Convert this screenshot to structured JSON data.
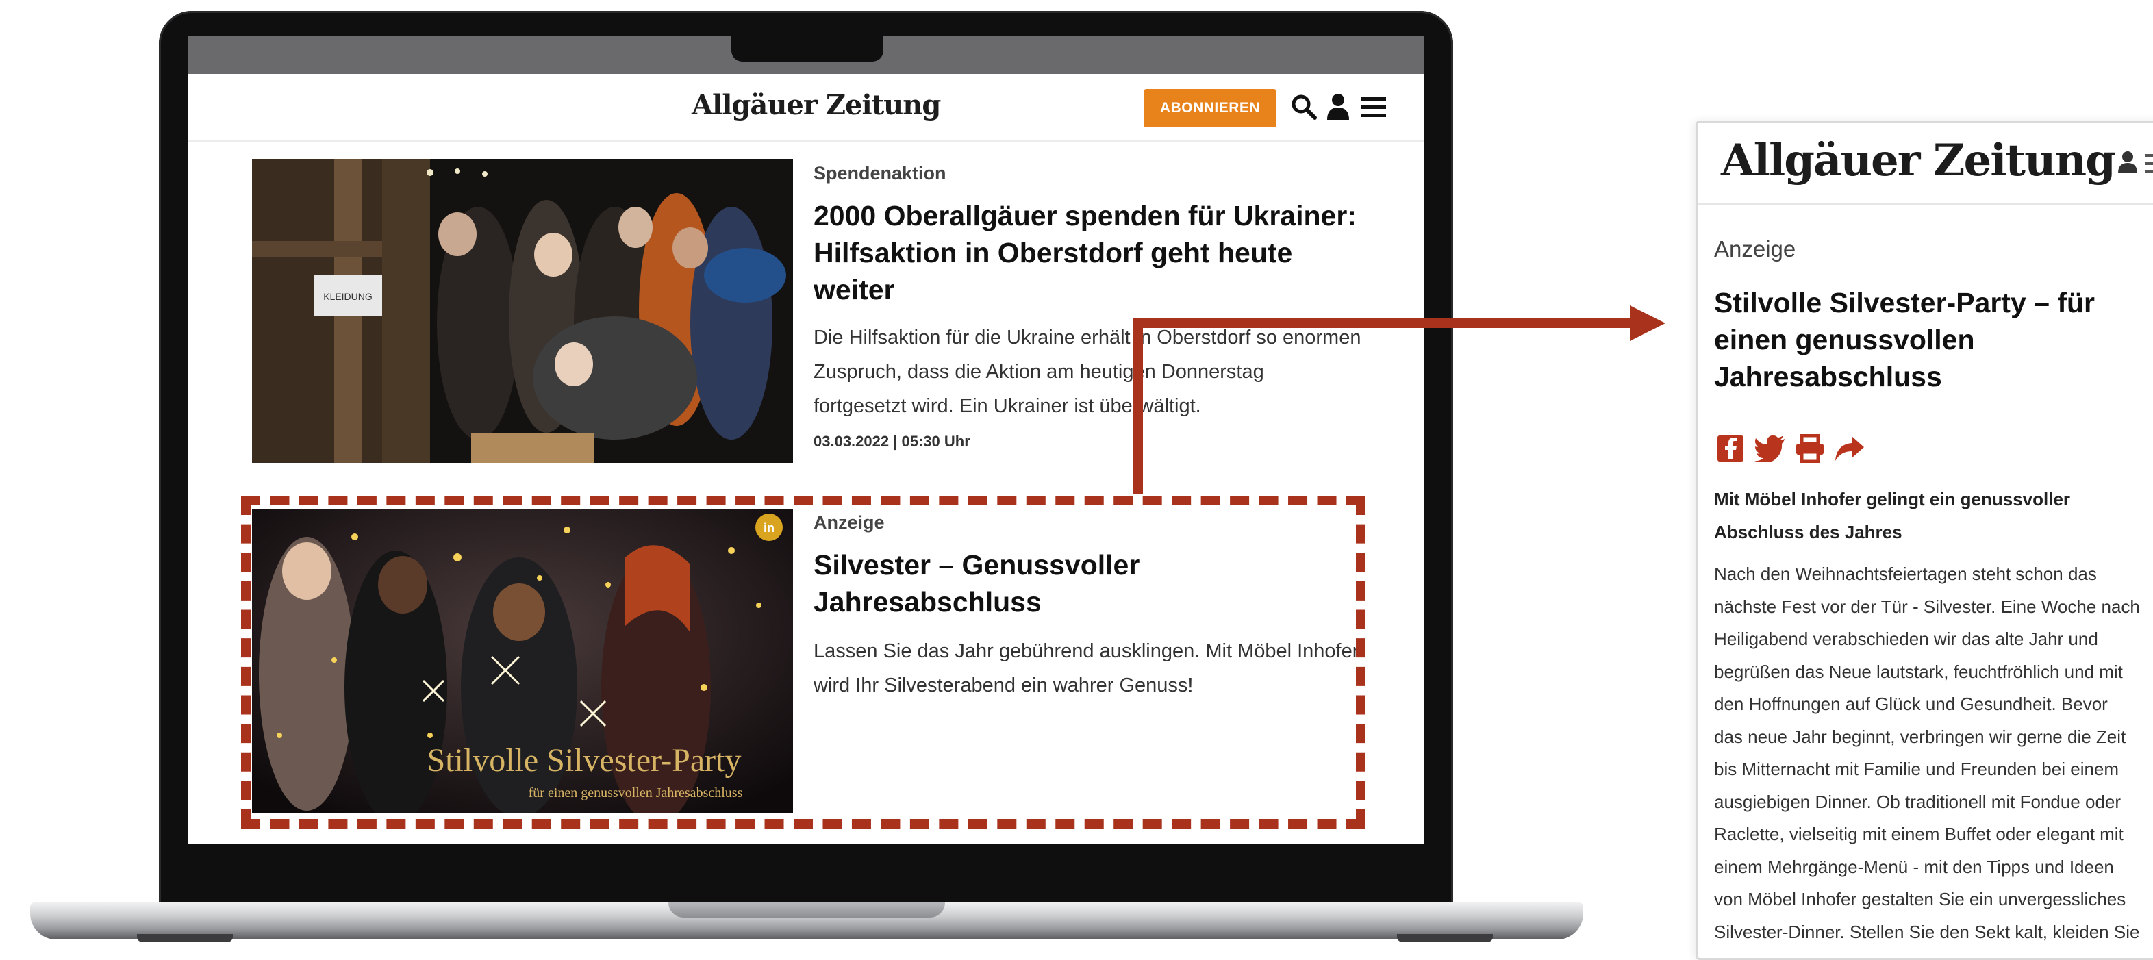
{
  "laptop": {
    "site": {
      "logo": "Allgäuer Zeitung",
      "subscribe_label": "ABONNIEREN",
      "header_icons": [
        "search-icon",
        "user-icon",
        "menu-icon"
      ]
    },
    "articles": [
      {
        "kicker": "Spendenaktion",
        "title": "2000 Oberallgäuer spenden für Ukrainer: Hilfsaktion in Oberstdorf geht heute weiter",
        "teaser": "Die Hilfsaktion für die Ukraine erhält in Oberstdorf so enormen Zuspruch, dass die Aktion am heutigen Donnerstag fortgesetzt wird. Ein Ukrainer ist überwältigt.",
        "date": "03.03.2022 | 05:30 Uhr",
        "image_sign": "KLEIDUNG"
      },
      {
        "kicker": "Anzeige",
        "title": "Silvester – Genussvoller Jahresabschluss",
        "teaser": "Lassen Sie das Jahr gebührend ausklingen. Mit Möbel Inhofer wird Ihr Silvesterabend ein wahrer Genuss!",
        "image_caption": "Stilvolle Silvester-Party",
        "image_subcaption": "für einen genussvollen Jahresabschluss"
      }
    ]
  },
  "phone": {
    "logo": "Allgäuer Zeitung",
    "kicker": "Anzeige",
    "title": "Stilvolle Silvester-Party – für einen genussvollen Jahresabschluss",
    "share_icons": [
      "facebook-icon",
      "twitter-icon",
      "print-icon",
      "share-icon"
    ],
    "subheading": "Mit Möbel Inhofer gelingt ein genussvoller Abschluss des Jahres",
    "body": "Nach den Weihnachtsfeiertagen steht schon das\nnächste Fest vor der Tür - Silvester. Eine Woche nach\nHeiligabend verabschieden wir das alte Jahr und\nbegrüßen das Neue lautstark, feuchtfröhlich und mit\nden Hoffnungen auf Glück und Gesundheit. Bevor\ndas neue Jahr beginnt, verbringen wir gerne die Zeit\nbis Mitternacht mit Familie und Freunden bei einem\nausgiebigen Dinner. Ob traditionell mit Fondue oder\nRaclette, vielseitig mit einem Buffet oder elegant mit\neinem Mehrgänge-Menü - mit den Tipps und Ideen\nvon Möbel Inhofer gestalten Sie ein unvergessliches\nSilvester-Dinner. Stellen Sie den Sekt kalt, kleiden Sie"
  },
  "colors": {
    "accent_orange": "#e8821b",
    "highlight_red": "#a8321c"
  }
}
